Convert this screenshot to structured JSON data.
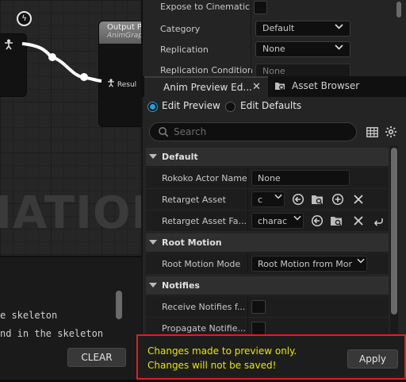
{
  "graph": {
    "watermark": "IATION",
    "output_node_title": "Output P",
    "output_node_subtitle": "AnimGrap",
    "output_pin_label": "Resul",
    "lightning_glyph": "ϟ"
  },
  "log": {
    "line1": "e skeleton",
    "line2": "nd in the skeleton",
    "clear_label": "CLEAR"
  },
  "details_top": {
    "expose_label": "Expose to Cinematic",
    "category_label": "Category",
    "category_value": "Default",
    "replication_label": "Replication",
    "replication_value": "None",
    "replication_condition_label": "Replication Condition",
    "replication_condition_value": "None"
  },
  "tabs": {
    "anim_preview": "Anim Preview Ed...",
    "asset_browser": "Asset Browser"
  },
  "mode": {
    "edit_preview": "Edit Preview",
    "edit_defaults": "Edit Defaults"
  },
  "search": {
    "placeholder": "Search"
  },
  "sections": {
    "default": {
      "title": "Default",
      "rokoko_label": "Rokoko Actor Name",
      "rokoko_value": "None",
      "retarget_asset_label": "Retarget Asset",
      "retarget_asset_value": "c",
      "retarget_asset_fa_label": "Retarget Asset Fa...",
      "retarget_asset_fa_value": "charac"
    },
    "root_motion": {
      "title": "Root Motion",
      "mode_label": "Root Motion Mode",
      "mode_value": "Root Motion from Mor"
    },
    "notifies": {
      "title": "Notifies",
      "receive_label": "Receive Notifies f...",
      "propagate_label": "Propagate Notifie..."
    }
  },
  "notice": {
    "message": "Changes made to preview only. Changes will not be saved!",
    "apply_label": "Apply"
  },
  "colors": {
    "accent": "#26a0da",
    "warning_text": "#e6e600",
    "highlight_border": "#e31b23"
  }
}
